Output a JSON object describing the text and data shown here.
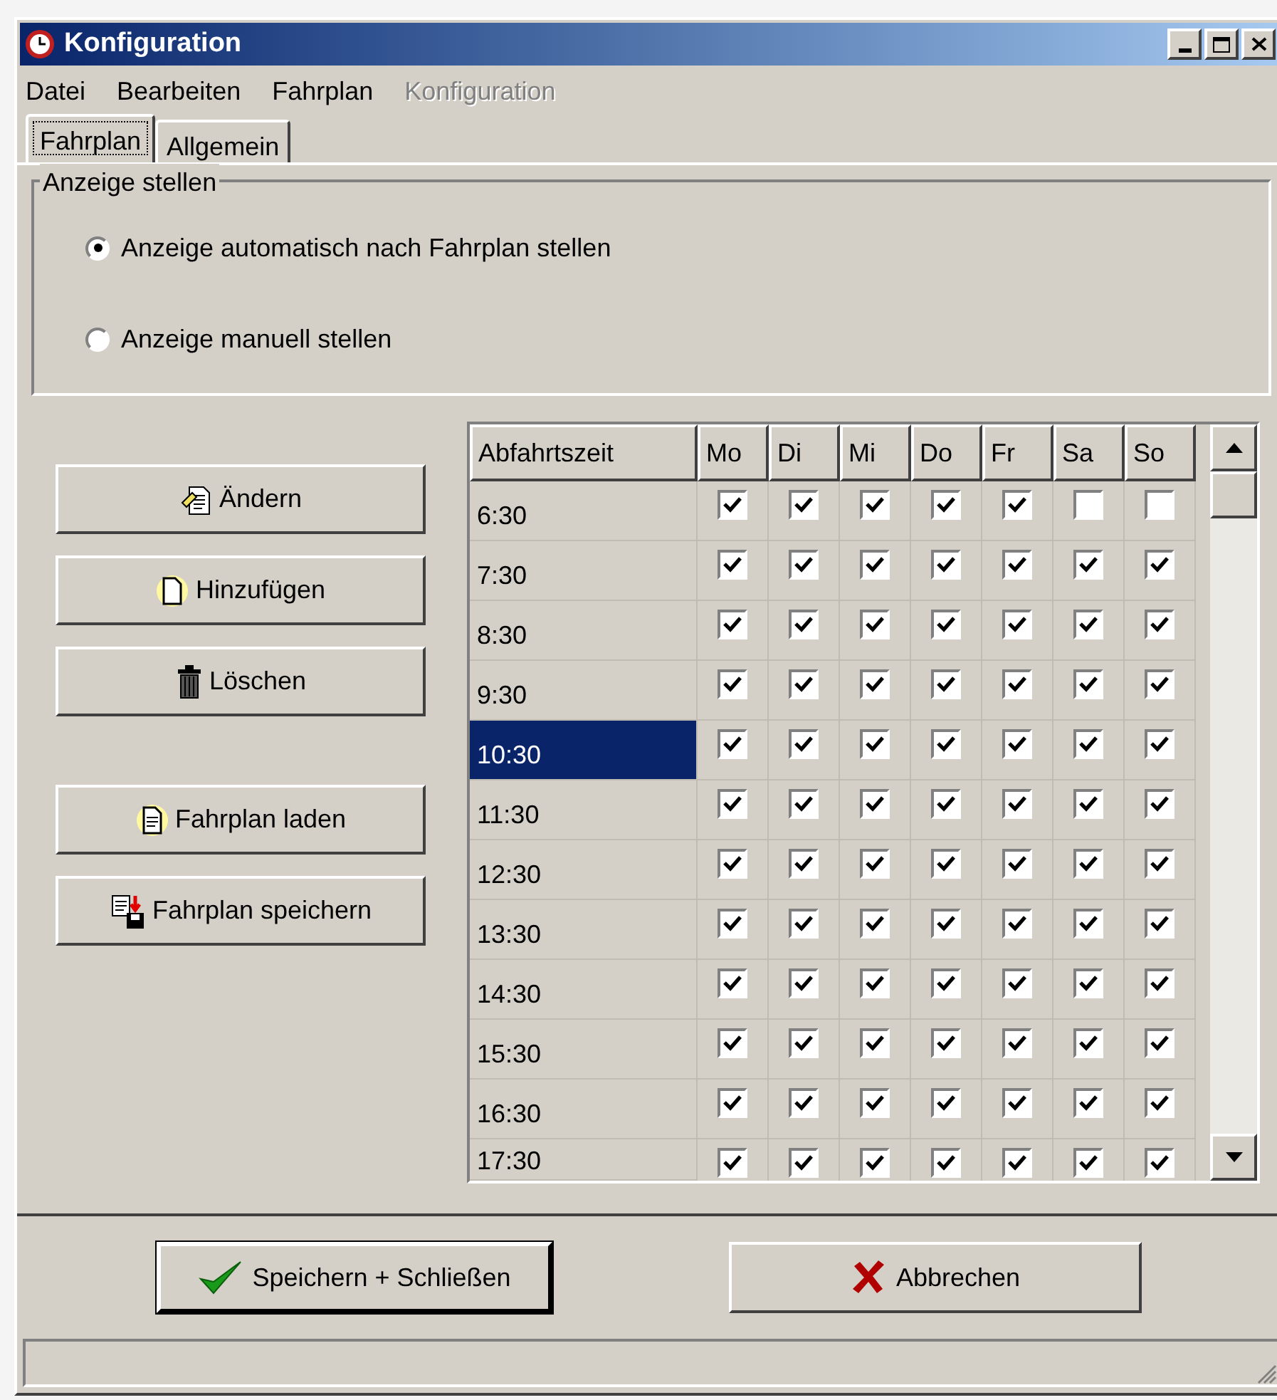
{
  "window": {
    "title": "Konfiguration"
  },
  "menu": [
    {
      "label": "Datei",
      "disabled": false
    },
    {
      "label": "Bearbeiten",
      "disabled": false
    },
    {
      "label": "Fahrplan",
      "disabled": false
    },
    {
      "label": "Konfiguration",
      "disabled": true
    }
  ],
  "tabs": [
    {
      "label": "Fahrplan",
      "selected": true
    },
    {
      "label": "Allgemein",
      "selected": false
    }
  ],
  "display_group": {
    "title": "Anzeige stellen",
    "options": [
      {
        "label": "Anzeige automatisch nach Fahrplan stellen",
        "selected": true
      },
      {
        "label": "Anzeige manuell stellen",
        "selected": false
      }
    ]
  },
  "side_buttons": [
    {
      "label": "Ändern",
      "kind": "edit"
    },
    {
      "label": "Hinzufügen",
      "kind": "add"
    },
    {
      "label": "Löschen",
      "kind": "delete"
    },
    {
      "label": "Fahrplan laden",
      "kind": "load"
    },
    {
      "label": "Fahrplan speichern",
      "kind": "save"
    }
  ],
  "table": {
    "columns": [
      "Abfahrtszeit",
      "Mo",
      "Di",
      "Mi",
      "Do",
      "Fr",
      "Sa",
      "So"
    ],
    "rows": [
      {
        "time": "6:30",
        "selected": false,
        "days": [
          {
            "checked": true
          },
          {
            "checked": true
          },
          {
            "checked": true
          },
          {
            "checked": true
          },
          {
            "checked": true
          },
          {
            "checked": false
          },
          {
            "checked": false
          }
        ]
      },
      {
        "time": "7:30",
        "selected": false,
        "days": [
          {
            "checked": true
          },
          {
            "checked": true
          },
          {
            "checked": true
          },
          {
            "checked": true
          },
          {
            "checked": true
          },
          {
            "checked": true
          },
          {
            "checked": true
          }
        ]
      },
      {
        "time": "8:30",
        "selected": false,
        "days": [
          {
            "checked": true
          },
          {
            "checked": true
          },
          {
            "checked": true
          },
          {
            "checked": true
          },
          {
            "checked": true
          },
          {
            "checked": true
          },
          {
            "checked": true
          }
        ]
      },
      {
        "time": "9:30",
        "selected": false,
        "days": [
          {
            "checked": true
          },
          {
            "checked": true
          },
          {
            "checked": true
          },
          {
            "checked": true
          },
          {
            "checked": true
          },
          {
            "checked": true
          },
          {
            "checked": true
          }
        ]
      },
      {
        "time": "10:30",
        "selected": true,
        "days": [
          {
            "checked": true
          },
          {
            "checked": true
          },
          {
            "checked": true
          },
          {
            "checked": true
          },
          {
            "checked": true
          },
          {
            "checked": true
          },
          {
            "checked": true
          }
        ]
      },
      {
        "time": "11:30",
        "selected": false,
        "days": [
          {
            "checked": true
          },
          {
            "checked": true
          },
          {
            "checked": true
          },
          {
            "checked": true
          },
          {
            "checked": true
          },
          {
            "checked": true
          },
          {
            "checked": true
          }
        ]
      },
      {
        "time": "12:30",
        "selected": false,
        "days": [
          {
            "checked": true
          },
          {
            "checked": true
          },
          {
            "checked": true
          },
          {
            "checked": true
          },
          {
            "checked": true
          },
          {
            "checked": true
          },
          {
            "checked": true
          }
        ]
      },
      {
        "time": "13:30",
        "selected": false,
        "days": [
          {
            "checked": true
          },
          {
            "checked": true
          },
          {
            "checked": true
          },
          {
            "checked": true
          },
          {
            "checked": true
          },
          {
            "checked": true
          },
          {
            "checked": true
          }
        ]
      },
      {
        "time": "14:30",
        "selected": false,
        "days": [
          {
            "checked": true
          },
          {
            "checked": true
          },
          {
            "checked": true
          },
          {
            "checked": true
          },
          {
            "checked": true
          },
          {
            "checked": true
          },
          {
            "checked": true
          }
        ]
      },
      {
        "time": "15:30",
        "selected": false,
        "days": [
          {
            "checked": true
          },
          {
            "checked": true
          },
          {
            "checked": true
          },
          {
            "checked": true
          },
          {
            "checked": true
          },
          {
            "checked": true
          },
          {
            "checked": true
          }
        ]
      },
      {
        "time": "16:30",
        "selected": false,
        "days": [
          {
            "checked": true
          },
          {
            "checked": true
          },
          {
            "checked": true
          },
          {
            "checked": true
          },
          {
            "checked": true
          },
          {
            "checked": true
          },
          {
            "checked": true
          }
        ]
      },
      {
        "time": "17:30",
        "selected": false,
        "days": [
          {
            "checked": true
          },
          {
            "checked": true
          },
          {
            "checked": true
          },
          {
            "checked": true
          },
          {
            "checked": true
          },
          {
            "checked": true
          },
          {
            "checked": true
          }
        ]
      }
    ]
  },
  "footer_buttons": [
    {
      "label": "Speichern + Schließen",
      "kind": "ok",
      "default": true
    },
    {
      "label": "Abbrechen",
      "kind": "cancel",
      "default": false
    }
  ]
}
